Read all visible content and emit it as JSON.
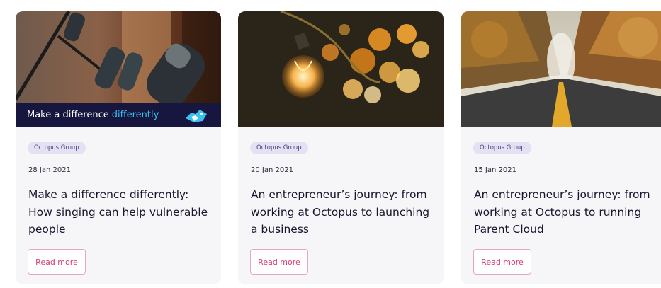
{
  "cards": [
    {
      "image_icon": "microphones-photo",
      "banner_text": "Make a difference",
      "banner_accent": "differently",
      "tag": "Octopus Group",
      "date": "28 Jan 2021",
      "title": "Make a difference differently: How singing can help vulnerable people",
      "button": "Read more"
    },
    {
      "image_icon": "lightbulb-bokeh-photo",
      "tag": "Octopus Group",
      "date": "20 Jan 2021",
      "title": "An entrepreneur’s journey: from working at Octopus to launching a business",
      "button": "Read more"
    },
    {
      "image_icon": "autumn-road-photo",
      "tag": "Octopus Group",
      "date": "15 Jan 2021",
      "title": "An entrepreneur’s journey: from working at Octopus to running Parent Cloud",
      "button": "Read more"
    }
  ],
  "colors": {
    "tag_bg": "#e3e1f2",
    "tag_text": "#45418a",
    "button_text": "#d63e70",
    "button_border": "#e7a7bd",
    "banner_bg": "#17163f",
    "banner_accent": "#39c2f0"
  }
}
